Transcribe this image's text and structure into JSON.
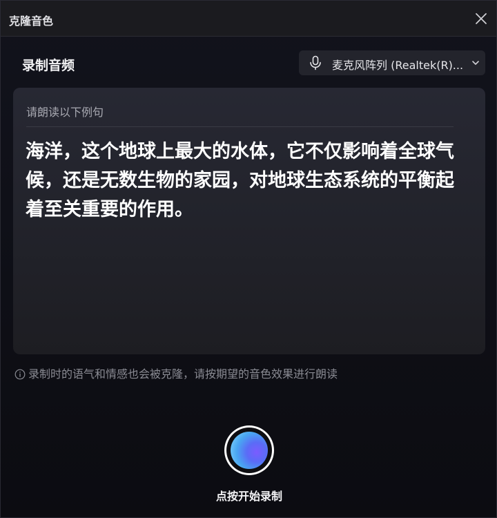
{
  "window": {
    "title": "克隆音色",
    "close_icon": "close-icon"
  },
  "recording": {
    "section_title": "录制音频",
    "microphone": {
      "selected": "麦克风阵列 (Realtek(R)...",
      "icon": "microphone-icon",
      "dropdown_icon": "chevron-down-icon"
    },
    "prompt": {
      "hint": "请朗读以下例句",
      "sentence": "海洋，这个地球上最大的水体，它不仅影响着全球气候，还是无数生物的家园，对地球生态系统的平衡起着至关重要的作用。"
    },
    "tip": "录制时的语气和情感也会被克隆，请按期望的音色效果进行朗读",
    "record_button_label": "点按开始录制"
  },
  "colors": {
    "accent_gradient": [
      "#7a5cff",
      "#49a6f2",
      "#8fe0ff"
    ],
    "background": "#0c0c10",
    "panel": "#262731"
  }
}
